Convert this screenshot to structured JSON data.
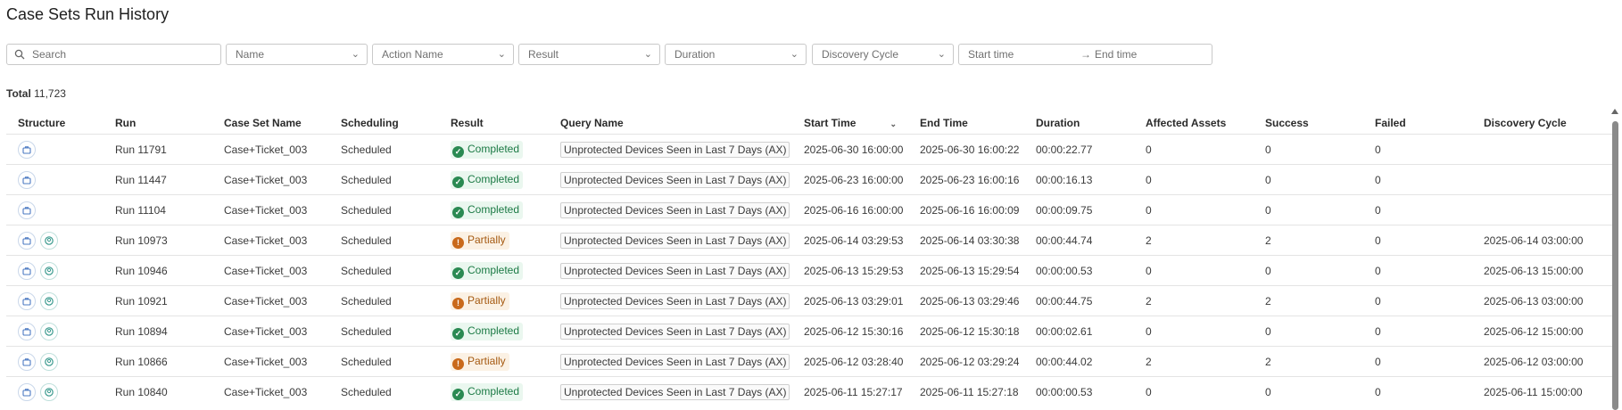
{
  "page": {
    "title": "Case Sets Run History"
  },
  "filters": {
    "search_placeholder": "Search",
    "name": "Name",
    "action_name": "Action Name",
    "result": "Result",
    "duration": "Duration",
    "discovery_cycle": "Discovery Cycle",
    "start_time": "Start time",
    "arrow": "→",
    "end_time": "End time"
  },
  "total": {
    "label": "Total",
    "value": "11,723"
  },
  "table": {
    "columns": [
      "Structure",
      "Run",
      "Case Set Name",
      "Scheduling",
      "Result",
      "Query Name",
      "Start Time",
      "End Time",
      "Duration",
      "Affected Assets",
      "Success",
      "Failed",
      "Discovery Cycle"
    ],
    "sort_indicator": "⌄",
    "rows": [
      {
        "customer_icon": false,
        "run": "Run 11791",
        "case_set": "Case+Ticket_003",
        "scheduling": "Scheduled",
        "result": "Completed",
        "result_status": "ok",
        "query": "Unprotected Devices Seen in Last 7 Days (AX)",
        "start": "2025-06-30 16:00:00",
        "end": "2025-06-30 16:00:22",
        "duration": "00:00:22.77",
        "affected": "0",
        "success": "0",
        "failed": "0",
        "discovery": ""
      },
      {
        "customer_icon": false,
        "run": "Run 11447",
        "case_set": "Case+Ticket_003",
        "scheduling": "Scheduled",
        "result": "Completed",
        "result_status": "ok",
        "query": "Unprotected Devices Seen in Last 7 Days (AX)",
        "start": "2025-06-23 16:00:00",
        "end": "2025-06-23 16:00:16",
        "duration": "00:00:16.13",
        "affected": "0",
        "success": "0",
        "failed": "0",
        "discovery": ""
      },
      {
        "customer_icon": false,
        "run": "Run 11104",
        "case_set": "Case+Ticket_003",
        "scheduling": "Scheduled",
        "result": "Completed",
        "result_status": "ok",
        "query": "Unprotected Devices Seen in Last 7 Days (AX)",
        "start": "2025-06-16 16:00:00",
        "end": "2025-06-16 16:00:09",
        "duration": "00:00:09.75",
        "affected": "0",
        "success": "0",
        "failed": "0",
        "discovery": ""
      },
      {
        "customer_icon": true,
        "run": "Run 10973",
        "case_set": "Case+Ticket_003",
        "scheduling": "Scheduled",
        "result": "Partially",
        "result_status": "part",
        "query": "Unprotected Devices Seen in Last 7 Days (AX)",
        "start": "2025-06-14 03:29:53",
        "end": "2025-06-14 03:30:38",
        "duration": "00:00:44.74",
        "affected": "2",
        "success": "2",
        "failed": "0",
        "discovery": "2025-06-14 03:00:00"
      },
      {
        "customer_icon": true,
        "run": "Run 10946",
        "case_set": "Case+Ticket_003",
        "scheduling": "Scheduled",
        "result": "Completed",
        "result_status": "ok",
        "query": "Unprotected Devices Seen in Last 7 Days (AX)",
        "start": "2025-06-13 15:29:53",
        "end": "2025-06-13 15:29:54",
        "duration": "00:00:00.53",
        "affected": "0",
        "success": "0",
        "failed": "0",
        "discovery": "2025-06-13 15:00:00"
      },
      {
        "customer_icon": true,
        "run": "Run 10921",
        "case_set": "Case+Ticket_003",
        "scheduling": "Scheduled",
        "result": "Partially",
        "result_status": "part",
        "query": "Unprotected Devices Seen in Last 7 Days (AX)",
        "start": "2025-06-13 03:29:01",
        "end": "2025-06-13 03:29:46",
        "duration": "00:00:44.75",
        "affected": "2",
        "success": "2",
        "failed": "0",
        "discovery": "2025-06-13 03:00:00"
      },
      {
        "customer_icon": true,
        "run": "Run 10894",
        "case_set": "Case+Ticket_003",
        "scheduling": "Scheduled",
        "result": "Completed",
        "result_status": "ok",
        "query": "Unprotected Devices Seen in Last 7 Days (AX)",
        "start": "2025-06-12 15:30:16",
        "end": "2025-06-12 15:30:18",
        "duration": "00:00:02.61",
        "affected": "0",
        "success": "0",
        "failed": "0",
        "discovery": "2025-06-12 15:00:00"
      },
      {
        "customer_icon": true,
        "run": "Run 10866",
        "case_set": "Case+Ticket_003",
        "scheduling": "Scheduled",
        "result": "Partially",
        "result_status": "part",
        "query": "Unprotected Devices Seen in Last 7 Days (AX)",
        "start": "2025-06-12 03:28:40",
        "end": "2025-06-12 03:29:24",
        "duration": "00:00:44.02",
        "affected": "2",
        "success": "2",
        "failed": "0",
        "discovery": "2025-06-12 03:00:00"
      },
      {
        "customer_icon": true,
        "run": "Run 10840",
        "case_set": "Case+Ticket_003",
        "scheduling": "Scheduled",
        "result": "Completed",
        "result_status": "ok",
        "query": "Unprotected Devices Seen in Last 7 Days (AX)",
        "start": "2025-06-11 15:27:17",
        "end": "2025-06-11 15:27:18",
        "duration": "00:00:00.53",
        "affected": "0",
        "success": "0",
        "failed": "0",
        "discovery": "2025-06-11 15:00:00"
      }
    ]
  },
  "icons": {
    "structure_primary": "briefcase-icon",
    "structure_secondary": "customer-icon",
    "status_ok": "check-icon",
    "status_partial": "exclamation-icon",
    "search": "search-icon"
  },
  "colors": {
    "completed": "#1c7a45",
    "partial": "#a55a12",
    "icon_blue": "#4a78c2",
    "icon_teal": "#3a9a8e"
  }
}
